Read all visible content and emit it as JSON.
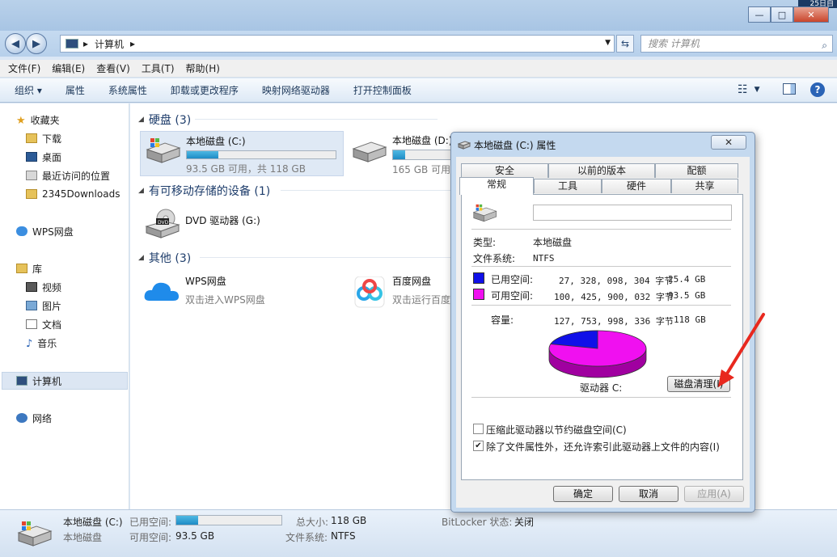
{
  "window": {
    "clock_text": "25日自",
    "minimize": "—",
    "maximize": "□",
    "close": "✕"
  },
  "address": {
    "path": "计算机",
    "search_placeholder": "搜索 计算机"
  },
  "menu": [
    "文件(F)",
    "编辑(E)",
    "查看(V)",
    "工具(T)",
    "帮助(H)"
  ],
  "toolbar": [
    "组织 ▾",
    "属性",
    "系统属性",
    "卸载或更改程序",
    "映射网络驱动器",
    "打开控制面板"
  ],
  "sidebar": {
    "favorites": "收藏夹",
    "downloads": "下载",
    "desktop": "桌面",
    "recent": "最近访问的位置",
    "custom": "2345Downloads",
    "wps": "WPS网盘",
    "library": "库",
    "video": "视频",
    "pictures": "图片",
    "docs": "文档",
    "music": "音乐",
    "computer": "计算机",
    "network": "网络"
  },
  "groups": {
    "hdd": "硬盘 (3)",
    "removable": "有可移动存储的设备 (1)",
    "other": "其他 (3)"
  },
  "drives": {
    "c": {
      "name": "本地磁盘 (C:)",
      "info": "93.5 GB 可用，共 118 GB",
      "used_fraction": 0.21
    },
    "d": {
      "name": "本地磁盘 (D:)",
      "info": "165 GB 可用",
      "used_fraction": 0.08
    },
    "dvd": {
      "name": "DVD 驱动器 (G:)"
    },
    "wps": {
      "name": "WPS网盘",
      "info": "双击进入WPS网盘"
    },
    "baidu": {
      "name": "百度网盘",
      "info": "双击运行百度"
    }
  },
  "status": {
    "drive_name": "本地磁盘 (C:)",
    "drive_type": "本地磁盘",
    "used_label": "已用空间:",
    "free_label": "可用空间:",
    "free_value": "93.5 GB",
    "total_label": "总大小:",
    "total_value": "118 GB",
    "fs_label": "文件系统:",
    "fs_value": "NTFS",
    "bitlocker_label": "BitLocker 状态:",
    "bitlocker_value": "关闭",
    "used_fraction": 0.21
  },
  "dialog": {
    "title": "本地磁盘 (C:) 属性",
    "tabs_top": [
      "安全",
      "以前的版本",
      "配额"
    ],
    "tabs_bottom": [
      "常规",
      "工具",
      "硬件",
      "共享"
    ],
    "type_label": "类型:",
    "type_value": "本地磁盘",
    "fs_label": "文件系统:",
    "fs_value": "NTFS",
    "used_label": "已用空间:",
    "used_bytes": "27, 328, 098, 304 字节",
    "used_gb": "25.4 GB",
    "free_label": "可用空间:",
    "free_bytes": "100, 425, 900, 032 字节",
    "free_gb": "93.5 GB",
    "cap_label": "容量:",
    "cap_bytes": "127, 753, 998, 336 字节",
    "cap_gb": "118 GB",
    "drive_label": "驱动器 C:",
    "cleanup": "磁盘清理(I)",
    "compress": "压缩此驱动器以节约磁盘空间(C)",
    "index": "除了文件属性外，还允许索引此驱动器上文件的内容(I)",
    "ok": "确定",
    "cancel": "取消",
    "apply": "应用(A)",
    "used_color": "#1010e8",
    "free_color": "#f010f0"
  }
}
